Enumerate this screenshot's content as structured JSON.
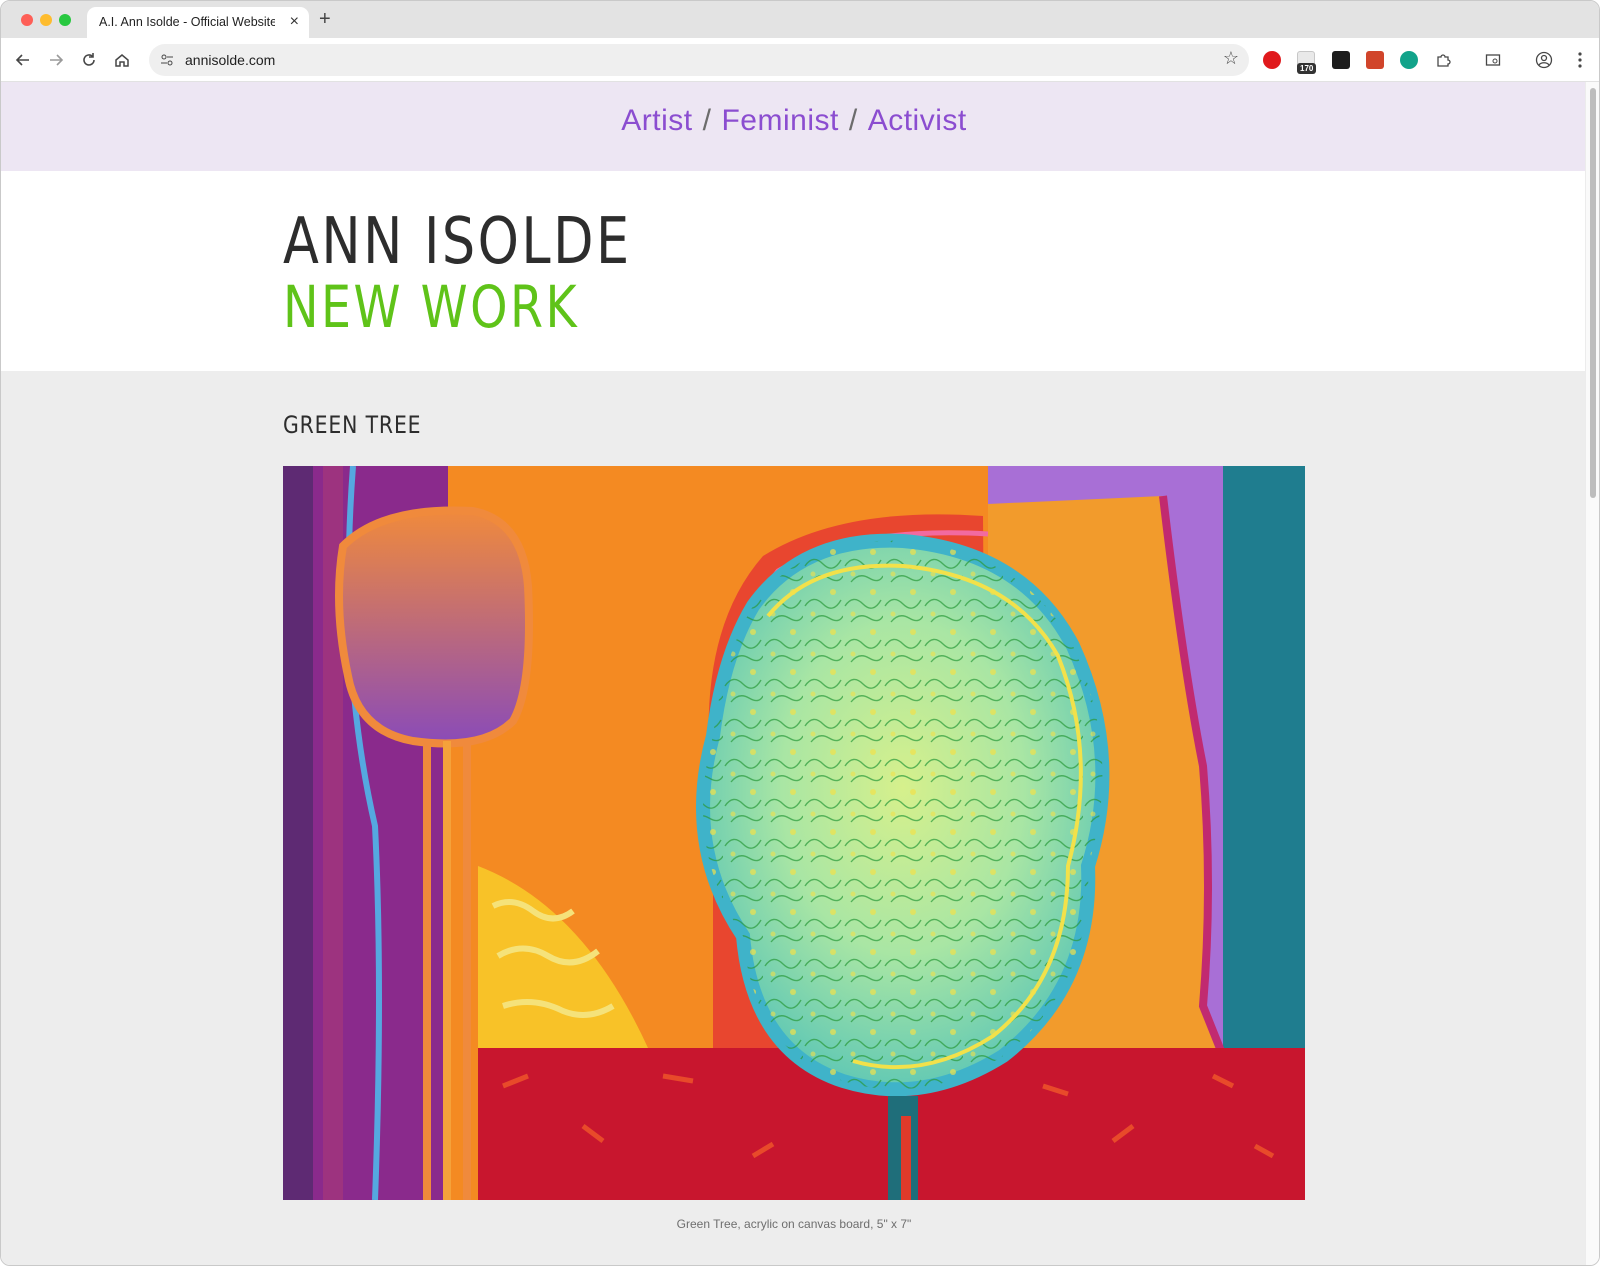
{
  "browser": {
    "tab_title": "A.I. Ann Isolde - Official Website",
    "tab_close": "×",
    "new_tab": "+",
    "url": "annisolde.com",
    "extension_badge": "170",
    "icons": {
      "back": "arrow-left",
      "forward": "arrow-right",
      "reload": "reload",
      "home": "home",
      "site_info": "tune",
      "bookmark": "star",
      "extensions": "puzzle",
      "profile": "person-circle",
      "menu": "kebab"
    }
  },
  "site": {
    "tagline": {
      "part1": "Artist",
      "sep1": "/",
      "part2": "Feminist",
      "sep2": "/",
      "part3": "Activist"
    },
    "name": "ANN ISOLDE",
    "subtitle": "NEW WORK",
    "colors": {
      "topbar_bg": "#ede6f3",
      "tagline": "#8b4dd0",
      "subtitle": "#5fc319",
      "content_bg": "#ededed"
    }
  },
  "artwork": {
    "title": "GREEN TREE",
    "caption": "Green Tree, acrylic on canvas board, 5\" x 7\""
  }
}
